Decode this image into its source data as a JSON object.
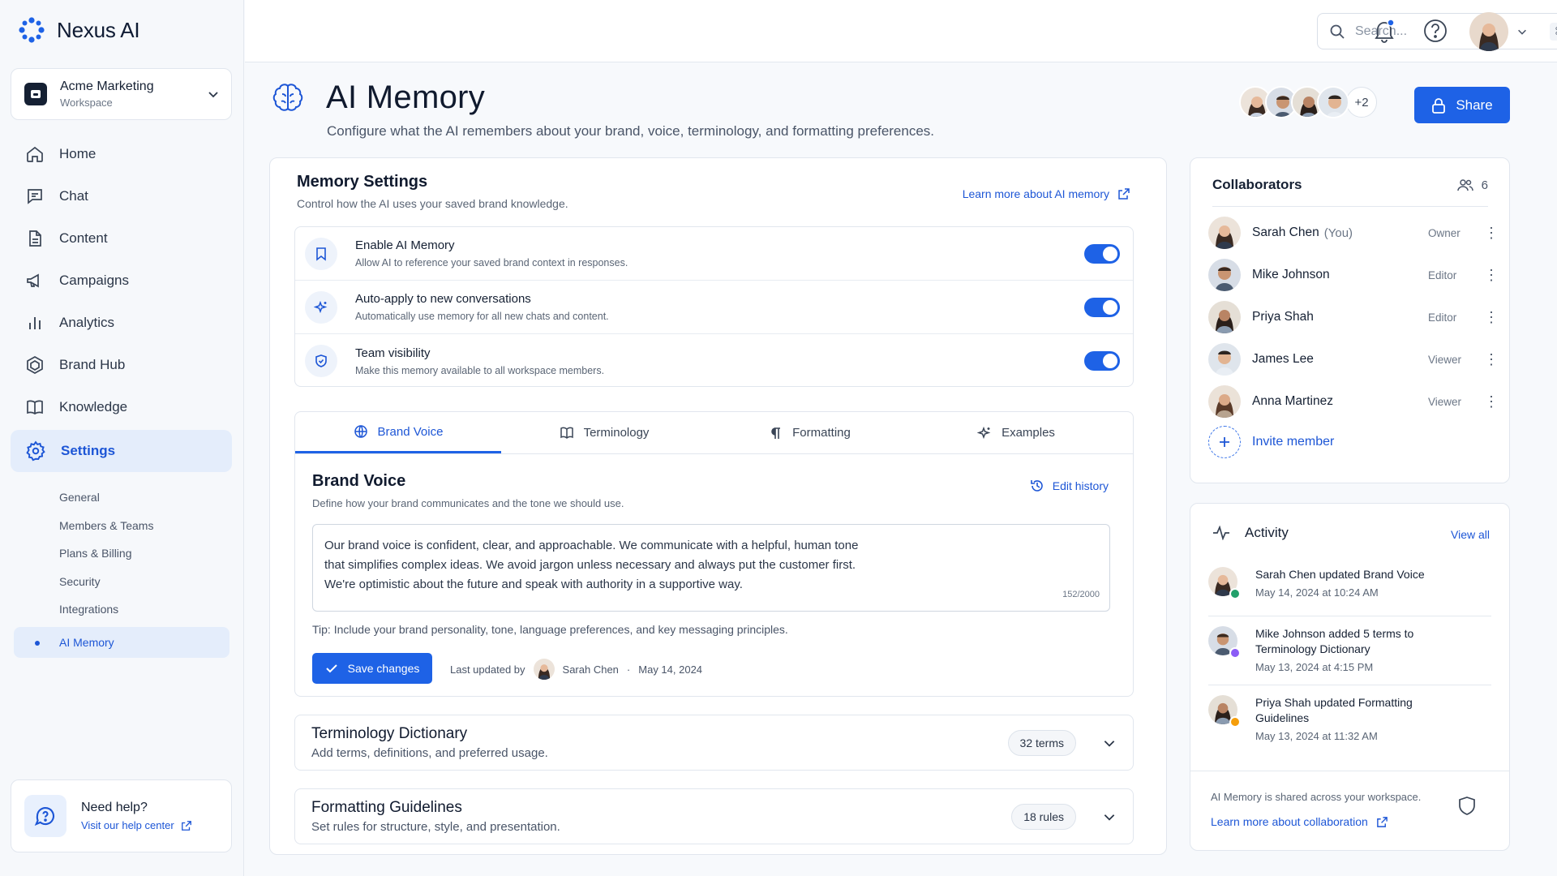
{
  "app": {
    "name": "Nexus AI",
    "brand_color": "#1e62e6"
  },
  "workspace": {
    "name": "Acme Marketing",
    "label": "Workspace"
  },
  "nav": {
    "items": [
      {
        "label": "Home",
        "icon": "home-icon"
      },
      {
        "label": "Chat",
        "icon": "chat-icon"
      },
      {
        "label": "Content",
        "icon": "document-icon"
      },
      {
        "label": "Campaigns",
        "icon": "megaphone-icon"
      },
      {
        "label": "Analytics",
        "icon": "bar-chart-icon"
      },
      {
        "label": "Brand Hub",
        "icon": "hexagon-icon"
      },
      {
        "label": "Knowledge",
        "icon": "book-icon"
      },
      {
        "label": "Settings",
        "icon": "gear-icon"
      }
    ],
    "active": "Settings",
    "sub_items": [
      "General",
      "Members & Teams",
      "Plans & Billing",
      "Security",
      "Integrations",
      "AI Memory"
    ],
    "active_sub": "AI Memory"
  },
  "help": {
    "title": "Need help?",
    "link": "Visit our help center"
  },
  "topbar": {
    "search_placeholder": "Search...",
    "shortcut": "⌘ K"
  },
  "page": {
    "title": "AI Memory",
    "subtitle": "Configure what the AI remembers about your brand, voice, terminology, and formatting preferences.",
    "extra_collaborators": "+2",
    "share_label": "Share"
  },
  "memory_settings": {
    "title": "Memory Settings",
    "subtitle": "Control how the AI uses your saved brand knowledge.",
    "learn_link": "Learn more about AI memory",
    "toggles": [
      {
        "title": "Enable AI Memory",
        "desc": "Allow AI to reference your saved brand context in responses.",
        "on": true
      },
      {
        "title": "Auto-apply to new conversations",
        "desc": "Automatically use memory for all new chats and content.",
        "on": true
      },
      {
        "title": "Team visibility",
        "desc": "Make this memory available to all workspace members.",
        "on": true
      }
    ]
  },
  "tabs": [
    {
      "label": "Brand Voice",
      "icon": "globe-icon"
    },
    {
      "label": "Terminology",
      "icon": "book-icon"
    },
    {
      "label": "Formatting",
      "icon": "pilcrow-icon"
    },
    {
      "label": "Examples",
      "icon": "sparkle-icon"
    }
  ],
  "brand_voice": {
    "title": "Brand Voice",
    "subtitle": "Define how your brand communicates and the tone we should use.",
    "edit_history": "Edit history",
    "text": "Our brand voice is confident, clear, and approachable. We communicate with a helpful, human tone that simplifies complex ideas. We avoid jargon unless necessary and always put the customer first. We're optimistic about the future and speak with authority in a supportive way.",
    "char_count": "152/2000",
    "tip": "Tip: Include your brand personality, tone, language preferences, and key messaging principles.",
    "save_label": "Save changes",
    "last_updated_label": "Last updated by",
    "last_updated_by": "Sarah Chen",
    "last_updated_date": "May 14, 2024"
  },
  "sections": [
    {
      "title": "Terminology Dictionary",
      "subtitle": "Add terms, definitions, and preferred usage.",
      "count": "32 terms"
    },
    {
      "title": "Formatting Guidelines",
      "subtitle": "Set rules for structure, style, and presentation.",
      "count": "18 rules"
    }
  ],
  "collaborators": {
    "title": "Collaborators",
    "count": "6",
    "members": [
      {
        "name": "Sarah Chen",
        "you": "(You)",
        "role": "Owner"
      },
      {
        "name": "Mike Johnson",
        "you": "",
        "role": "Editor"
      },
      {
        "name": "Priya Shah",
        "you": "",
        "role": "Editor"
      },
      {
        "name": "James Lee",
        "you": "",
        "role": "Viewer"
      },
      {
        "name": "Anna Martinez",
        "you": "",
        "role": "Viewer"
      }
    ],
    "invite_label": "Invite member"
  },
  "activity": {
    "title": "Activity",
    "view_all": "View all",
    "items": [
      {
        "text": "Sarah Chen updated Brand Voice",
        "time": "May 14, 2024 at 10:24 AM",
        "badge_color": "#22a06b"
      },
      {
        "text": "Mike Johnson added 5 terms to Terminology Dictionary",
        "time": "May 13, 2024 at 4:15 PM",
        "badge_color": "#8b5cf6"
      },
      {
        "text": "Priya Shah updated Formatting Guidelines",
        "time": "May 13, 2024 at 11:32 AM",
        "badge_color": "#f59e0b"
      }
    ],
    "footer_text": "AI Memory is shared across your workspace.",
    "footer_link": "Learn more about collaboration"
  }
}
